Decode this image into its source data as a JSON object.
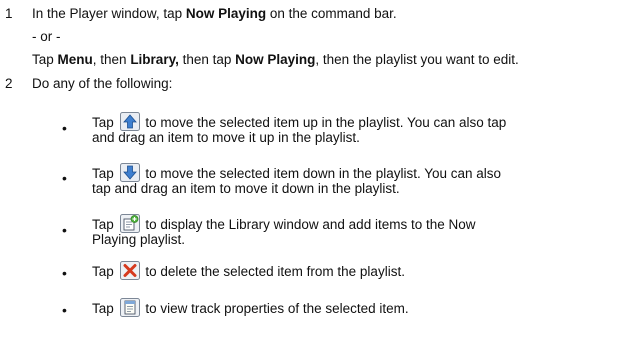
{
  "step1": {
    "number": "1",
    "line1": {
      "a": "In the Player window, tap ",
      "b": "Now Playing",
      "c": " on the command bar."
    },
    "or": "- or -",
    "line2": {
      "a": "Tap ",
      "b": "Menu",
      "c": ", then ",
      "d": "Library,",
      "e": " then tap ",
      "f": "Now Playing",
      "g": ", then the playlist you want to edit."
    }
  },
  "step2": {
    "number": "2",
    "intro": "Do any of the following:",
    "bullet_glyph": "•",
    "items": [
      {
        "icon": "up-arrow-icon",
        "tap": "Tap",
        "text": "to move the selected item up in the playlist. You can also tap and drag an item to move it up in the playlist."
      },
      {
        "icon": "down-arrow-icon",
        "tap": "Tap",
        "text": "to move the selected item down in the playlist. You can also tap and drag an item to move it down in the playlist."
      },
      {
        "icon": "add-to-playlist-icon",
        "tap": "Tap",
        "text": "to display the Library window and add items to the Now Playing playlist."
      },
      {
        "icon": "delete-icon",
        "tap": "Tap",
        "text": "to delete the selected item from the playlist."
      },
      {
        "icon": "properties-icon",
        "tap": "Tap",
        "text": "to view track properties of the selected item."
      }
    ]
  }
}
